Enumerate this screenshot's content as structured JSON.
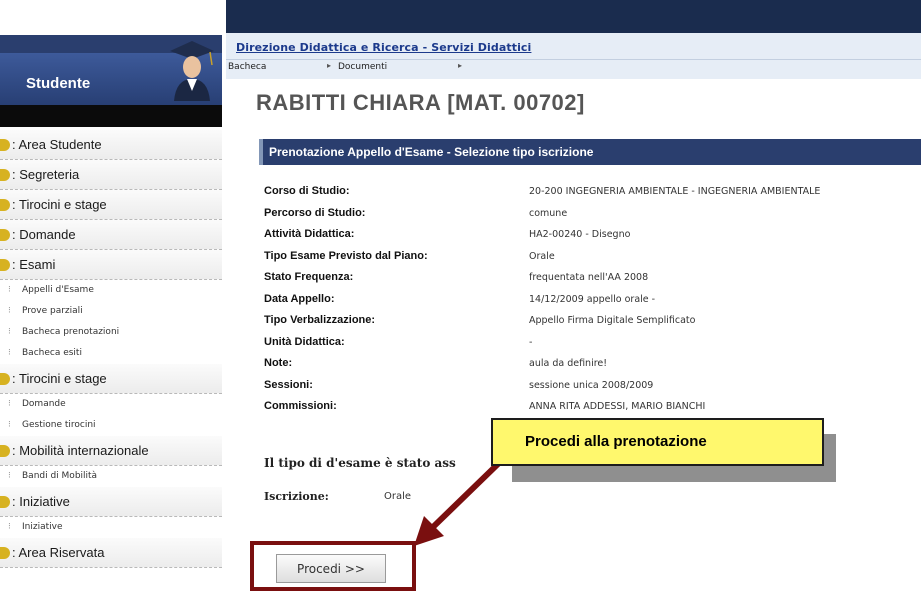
{
  "header": {
    "site_link": "Direzione Didattica e Ricerca - Servizi Didattici",
    "nav": [
      "Bacheca",
      "Documenti"
    ]
  },
  "sidebar": {
    "title": "Studente",
    "sections": [
      {
        "label": ": Area Studente",
        "items": []
      },
      {
        "label": ": Segreteria",
        "items": []
      },
      {
        "label": ": Tirocini e stage",
        "items": []
      },
      {
        "label": ": Domande",
        "items": []
      },
      {
        "label": ": Esami",
        "items": [
          "Appelli d'Esame",
          "Prove parziali",
          "Bacheca prenotazioni",
          "Bacheca esiti"
        ]
      },
      {
        "label": ": Tirocini e stage",
        "items": [
          "Domande",
          "Gestione tirocini"
        ]
      },
      {
        "label": ": Mobilità internazionale",
        "items": [
          "Bandi di Mobilità"
        ]
      },
      {
        "label": ": Iniziative",
        "items": [
          "Iniziative"
        ]
      },
      {
        "label": ": Area Riservata",
        "items": []
      }
    ]
  },
  "main": {
    "student_name": "RABITTI CHIARA [MAT. 00702]",
    "panel_title": "Prenotazione Appello d'Esame - Selezione tipo iscrizione",
    "details": [
      {
        "label": "Corso di Studio:",
        "value": "20-200 INGEGNERIA AMBIENTALE - INGEGNERIA AMBIENTALE"
      },
      {
        "label": "Percorso di Studio:",
        "value": "comune"
      },
      {
        "label": "Attività Didattica:",
        "value": "HA2-00240 - Disegno"
      },
      {
        "label": "Tipo Esame Previsto dal Piano:",
        "value": "Orale"
      },
      {
        "label": "Stato Frequenza:",
        "value": "frequentata nell'AA 2008"
      },
      {
        "label": "Data Appello:",
        "value": "14/12/2009 appello orale -"
      },
      {
        "label": "Tipo Verbalizzazione:",
        "value": "Appello Firma Digitale Semplificato"
      },
      {
        "label": "Unità Didattica:",
        "value": "-"
      },
      {
        "label": "Note:",
        "value": "aula da definire!"
      },
      {
        "label": "Sessioni:",
        "value": "sessione unica 2008/2009"
      },
      {
        "label": "Commissioni:",
        "value": "ANNA RITA ADDESSI, MARIO BIANCHI"
      }
    ],
    "exam_type_message": "Il tipo di d'esame è stato ass",
    "iscrizione_label": "Iscrizione:",
    "iscrizione_value": "Orale",
    "proceed_button": "Procedi >>",
    "callout_text": "Procedi alla prenotazione"
  },
  "colors": {
    "header_dark": "#1a2c4e",
    "panel_header": "#2a3e6e",
    "callout_fill": "#fff86d",
    "annotation_red": "#7a0f0f",
    "menu_bullet": "#d7b221"
  }
}
